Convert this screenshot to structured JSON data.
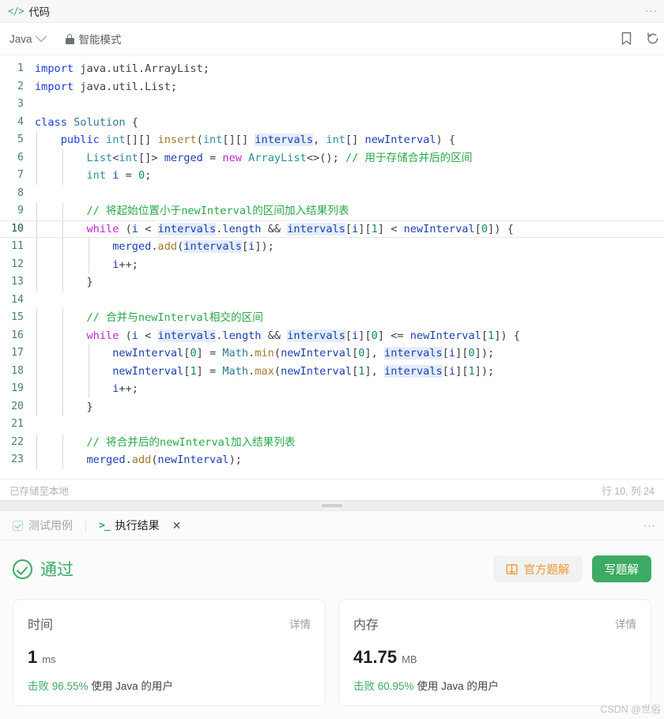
{
  "panel": {
    "title": "代码",
    "code_icon": "code-brackets-icon",
    "more_menu": "···"
  },
  "toolbar": {
    "language": "Java",
    "chevron_icon": "chevron-down-icon",
    "smart_mode": "智能模式",
    "lock_icon": "lock-icon",
    "bookmark_icon": "bookmark-icon",
    "reset_icon": "reset-icon"
  },
  "editor": {
    "active_line": 10,
    "status_left": "已存储至本地",
    "status_right": "行 10, 列 24",
    "lines": [
      {
        "n": "1",
        "html": "<span class=\"kb\">import</span> <span class=\"p\">java.util.ArrayList;</span>"
      },
      {
        "n": "2",
        "html": "<span class=\"kb\">import</span> <span class=\"p\">java.util.List;</span>"
      },
      {
        "n": "3",
        "html": ""
      },
      {
        "n": "4",
        "html": "<span class=\"kb\">class</span> <span class=\"cls\">Solution</span> <span class=\"p\">{</span>"
      },
      {
        "n": "5",
        "html": "    <span class=\"kb\">public</span> <span class=\"t\">int</span><span class=\"p\">[][]</span> <span class=\"fn\">insert</span><span class=\"p\">(</span><span class=\"t\">int</span><span class=\"p\">[][]</span> <span class=\"idh\">intervals</span><span class=\"p\">,</span> <span class=\"t\">int</span><span class=\"p\">[]</span> <span class=\"id\">newInterval</span><span class=\"p\">) {</span>"
      },
      {
        "n": "6",
        "html": "        <span class=\"t\">List</span><span class=\"p\">&lt;</span><span class=\"t\">int</span><span class=\"p\">[]&gt;</span> <span class=\"id\">merged</span> <span class=\"p\">=</span> <span class=\"k\">new</span> <span class=\"t\">ArrayList</span><span class=\"p\">&lt;&gt;();</span> <span class=\"cm\">// 用于存储合并后的区间</span>"
      },
      {
        "n": "7",
        "html": "        <span class=\"t\">int</span> <span class=\"id\">i</span> <span class=\"p\">=</span> <span class=\"num\">0</span><span class=\"p\">;</span>"
      },
      {
        "n": "8",
        "html": ""
      },
      {
        "n": "9",
        "html": "        <span class=\"cm\">// 将起始位置小于newInterval的区间加入结果列表</span>"
      },
      {
        "n": "10",
        "html": "        <span class=\"k\">while</span> <span class=\"p\">(</span><span class=\"id\">i</span> <span class=\"p\">&lt;</span> <span class=\"idh\">intervals</span><span class=\"p\">.</span><span class=\"id\">length</span> <span class=\"p\">&amp;&amp;</span> <span class=\"idh\">intervals</span><span class=\"p\">[</span><span class=\"id\">i</span><span class=\"p\">][</span><span class=\"num\">1</span><span class=\"p\">]</span> <span class=\"p\">&lt;</span> <span class=\"id\">newInterval</span><span class=\"p\">[</span><span class=\"num\">0</span><span class=\"p\">]) {</span>"
      },
      {
        "n": "11",
        "html": "            <span class=\"id\">merged</span><span class=\"p\">.</span><span class=\"fn\">add</span><span class=\"p\">(</span><span class=\"idh\">intervals</span><span class=\"p\">[</span><span class=\"id\">i</span><span class=\"p\">]);</span>"
      },
      {
        "n": "12",
        "html": "            <span class=\"id\">i</span><span class=\"p\">++;</span>"
      },
      {
        "n": "13",
        "html": "        <span class=\"p\">}</span>"
      },
      {
        "n": "14",
        "html": ""
      },
      {
        "n": "15",
        "html": "        <span class=\"cm\">// 合并与newInterval相交的区间</span>"
      },
      {
        "n": "16",
        "html": "        <span class=\"k\">while</span> <span class=\"p\">(</span><span class=\"id\">i</span> <span class=\"p\">&lt;</span> <span class=\"idh\">intervals</span><span class=\"p\">.</span><span class=\"id\">length</span> <span class=\"p\">&amp;&amp;</span> <span class=\"idh\">intervals</span><span class=\"p\">[</span><span class=\"id\">i</span><span class=\"p\">][</span><span class=\"num\">0</span><span class=\"p\">]</span> <span class=\"p\">&lt;=</span> <span class=\"id\">newInterval</span><span class=\"p\">[</span><span class=\"num\">1</span><span class=\"p\">]) {</span>"
      },
      {
        "n": "17",
        "html": "            <span class=\"id\">newInterval</span><span class=\"p\">[</span><span class=\"num\">0</span><span class=\"p\">]</span> <span class=\"p\">=</span> <span class=\"cls\">Math</span><span class=\"p\">.</span><span class=\"fn\">min</span><span class=\"p\">(</span><span class=\"id\">newInterval</span><span class=\"p\">[</span><span class=\"num\">0</span><span class=\"p\">],</span> <span class=\"idh\">intervals</span><span class=\"p\">[</span><span class=\"id\">i</span><span class=\"p\">][</span><span class=\"num\">0</span><span class=\"p\">]);</span>"
      },
      {
        "n": "18",
        "html": "            <span class=\"id\">newInterval</span><span class=\"p\">[</span><span class=\"num\">1</span><span class=\"p\">]</span> <span class=\"p\">=</span> <span class=\"cls\">Math</span><span class=\"p\">.</span><span class=\"fn\">max</span><span class=\"p\">(</span><span class=\"id\">newInterval</span><span class=\"p\">[</span><span class=\"num\">1</span><span class=\"p\">],</span> <span class=\"idh\">intervals</span><span class=\"p\">[</span><span class=\"id\">i</span><span class=\"p\">][</span><span class=\"num\">1</span><span class=\"p\">]);</span>"
      },
      {
        "n": "19",
        "html": "            <span class=\"id\">i</span><span class=\"p\">++;</span>"
      },
      {
        "n": "20",
        "html": "        <span class=\"p\">}</span>"
      },
      {
        "n": "21",
        "html": ""
      },
      {
        "n": "22",
        "html": "        <span class=\"cm\">// 将合并后的newInterval加入结果列表</span>"
      },
      {
        "n": "23",
        "html": "        <span class=\"id\">merged</span><span class=\"p\">.</span><span class=\"fn\">add</span><span class=\"p\">(</span><span class=\"id\">newInterval</span><span class=\"p\">);</span>"
      }
    ]
  },
  "result": {
    "tabs": [
      {
        "label": "测试用例",
        "icon": "check-square-icon",
        "active": false
      },
      {
        "label": "执行结果",
        "icon": "terminal-icon",
        "active": true,
        "closable": true,
        "close_icon": "close-icon"
      }
    ],
    "more_menu": "···",
    "verdict": {
      "text": "通过",
      "icon": "check-circle-icon",
      "color": "#3dab63"
    },
    "actions": {
      "official_solution": "官方题解",
      "official_icon": "book-icon",
      "write_solution": "写题解"
    },
    "cards": [
      {
        "label": "时间",
        "detail": "详情",
        "value": "1",
        "unit": "ms",
        "beat_prefix": "击败",
        "beat_pct": "96.55%",
        "beat_suffix": "使用 Java 的用户"
      },
      {
        "label": "内存",
        "detail": "详情",
        "value": "41.75",
        "unit": "MB",
        "beat_prefix": "击败",
        "beat_pct": "60.95%",
        "beat_suffix": "使用 Java 的用户"
      }
    ]
  },
  "watermark": "CSDN @世俗"
}
